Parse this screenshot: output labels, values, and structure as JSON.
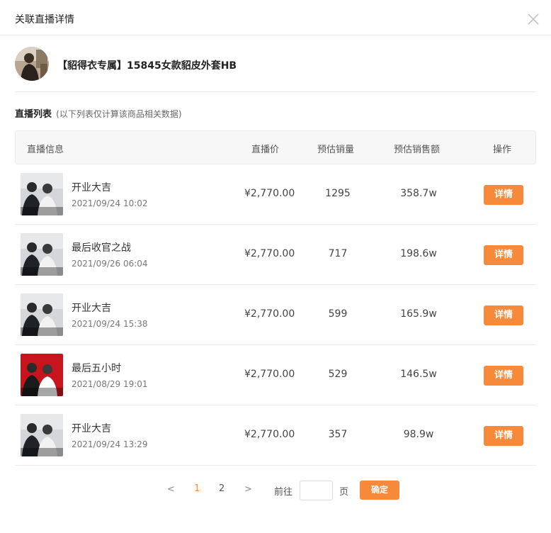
{
  "dialog": {
    "title": "关联直播详情",
    "close_icon": "close-icon"
  },
  "product": {
    "name": "【貂得衣专属】15845女款貂皮外套HB",
    "thumbnail_icon": "product-thumbnail"
  },
  "section": {
    "title": "直播列表",
    "note": "(以下列表仅计算该商品相关数据)"
  },
  "table": {
    "headers": [
      "直播信息",
      "直播价",
      "预估销量",
      "预估销售额",
      "操作"
    ],
    "rows": [
      {
        "title": "开业大吉",
        "time": "2021/09/24 10:02",
        "price": "¥2,770.00",
        "sales": "1295",
        "amount": "358.7w",
        "action": "详情",
        "cover_caption": "开业大吉",
        "cover_theme": "grey"
      },
      {
        "title": "最后收官之战",
        "time": "2021/09/26 06:04",
        "price": "¥2,770.00",
        "sales": "717",
        "amount": "198.6w",
        "action": "详情",
        "cover_caption": "最后收官之战",
        "cover_theme": "grey"
      },
      {
        "title": "开业大吉",
        "time": "2021/09/24 15:38",
        "price": "¥2,770.00",
        "sales": "599",
        "amount": "165.9w",
        "action": "详情",
        "cover_caption": "开业大吉",
        "cover_theme": "grey"
      },
      {
        "title": "最后五小时",
        "time": "2021/08/29 19:01",
        "price": "¥2,770.00",
        "sales": "529",
        "amount": "146.5w",
        "action": "详情",
        "cover_caption": "最后五小时",
        "cover_theme": "red"
      },
      {
        "title": "开业大吉",
        "time": "2021/09/24 13:29",
        "price": "¥2,770.00",
        "sales": "357",
        "amount": "98.9w",
        "action": "详情",
        "cover_caption": "开业大吉",
        "cover_theme": "grey"
      }
    ]
  },
  "pagination": {
    "prev": "<",
    "pages": [
      "1",
      "2"
    ],
    "current": "1",
    "next": ">",
    "goto_label": "前往",
    "page_unit": "页",
    "goto_value": "",
    "confirm_label": "确定"
  },
  "colors": {
    "accent": "#f7893a",
    "header_bg": "#f7f7f7",
    "border": "#ebebeb",
    "red_cover": "#c8141c"
  }
}
